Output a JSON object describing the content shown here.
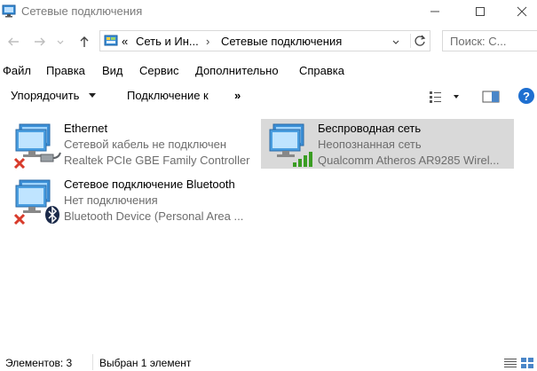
{
  "window": {
    "title": "Сетевые подключения"
  },
  "address": {
    "overflow": "«",
    "crumbs": [
      "Сеть и Ин...",
      "Сетевые подключения"
    ]
  },
  "search": {
    "placeholder": "Поиск: С..."
  },
  "menu": [
    "Файл",
    "Правка",
    "Вид",
    "Сервис",
    "Дополнительно",
    "Справка"
  ],
  "toolbar": {
    "organize": "Упорядочить",
    "connect": "Подключение к",
    "more": "»"
  },
  "connections": [
    {
      "name": "Ethernet",
      "status": "Сетевой кабель не подключен",
      "device": "Realtek PCIe GBE Family Controller"
    },
    {
      "name": "Беспроводная сеть",
      "status": "Неопознанная сеть",
      "device": "Qualcomm Atheros AR9285 Wirel..."
    },
    {
      "name": "Сетевое подключение Bluetooth",
      "status": "Нет подключения",
      "device": "Bluetooth Device (Personal Area ..."
    }
  ],
  "status": {
    "count": "Элементов: 3",
    "selected": "Выбран 1 элемент"
  },
  "colors": {
    "accent": "#1e6fd0",
    "error": "#d83b2b",
    "signal": "#3a9d23",
    "selection": "#d9d9d9"
  }
}
